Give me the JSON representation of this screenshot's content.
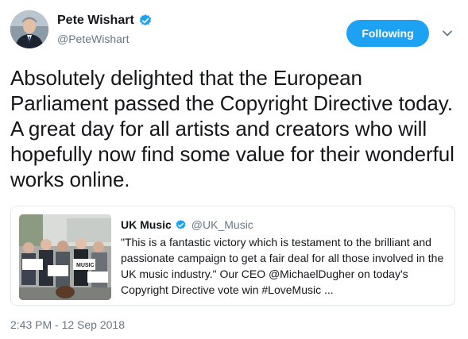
{
  "author": {
    "display_name": "Pete Wishart",
    "handle": "@PeteWishart",
    "verified": true
  },
  "follow_button": {
    "label": "Following"
  },
  "menu": {
    "icon": "chevron-down-icon"
  },
  "tweet": {
    "text": "Absolutely delighted that the European Parliament passed the Copyright Directive today. A great day for all artists and creators who will hopefully now find some value for their wonderful works online.",
    "timestamp": "2:43 PM - 12 Sep 2018"
  },
  "quoted_tweet": {
    "display_name": "UK Music",
    "handle": "@UK_Music",
    "verified": true,
    "text": "\"This is a fantastic victory which is testament to the brilliant and passionate campaign to get a fair deal for all those involved in the UK music industry.\" Our CEO @MichaelDugher on today's Copyright Directive vote win #LoveMusic ...",
    "media_sign_text": "MUSIC"
  },
  "colors": {
    "accent": "#1da1f2",
    "text": "#14171a",
    "secondary_text": "#657786",
    "border": "#e1e8ed"
  }
}
